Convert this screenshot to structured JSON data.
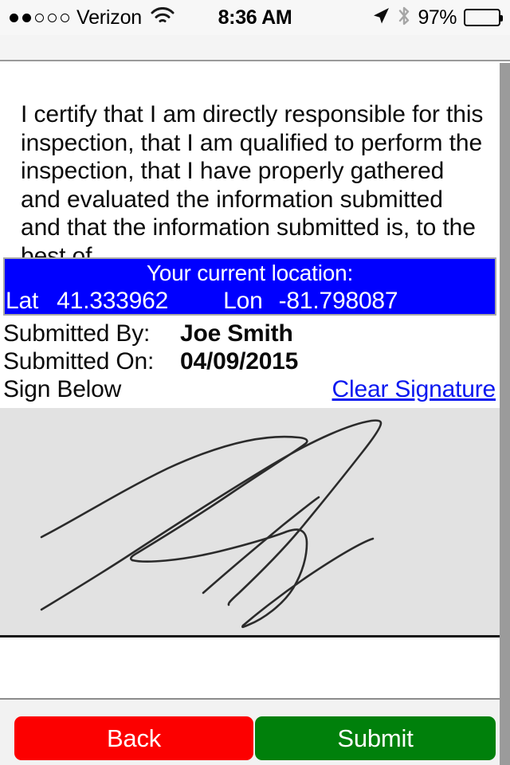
{
  "status_bar": {
    "signal_dots_filled": 2,
    "signal_dots_total": 5,
    "carrier": "Verizon",
    "wifi_icon": "wifi-icon",
    "time": "8:36 AM",
    "location_arrow_icon": "location-arrow-icon",
    "bluetooth_icon": "bluetooth-icon",
    "battery_percent": "97%",
    "battery_level": 97
  },
  "certification": {
    "text": "I certify that I am directly responsible for this inspection, that I am qualified to perform the inspection, that I have properly gathered and evaluated the information submitted and that the information submitted is, to the best of"
  },
  "location_banner": {
    "title": "Your current location:",
    "lat_label": "Lat",
    "lat_value": "41.333962",
    "lon_label": "Lon",
    "lon_value": "-81.798087",
    "background_color": "#0000FF",
    "text_color": "#FFFFFF"
  },
  "meta": {
    "submitted_by_label": "Submitted By:",
    "submitted_by_value": "Joe Smith",
    "submitted_on_label": "Submitted On:",
    "submitted_on_value": "04/09/2015",
    "sign_below_label": "Sign Below",
    "clear_signature_link": "Clear Signature",
    "link_color": "#0A18F0"
  },
  "signature": {
    "has_signature": true,
    "pad_background_color": "#E2E2E2",
    "ink_color": "#2B2B2B"
  },
  "footer": {
    "back_label": "Back",
    "back_color": "#FC0000",
    "submit_label": "Submit",
    "submit_color": "#00800B"
  }
}
